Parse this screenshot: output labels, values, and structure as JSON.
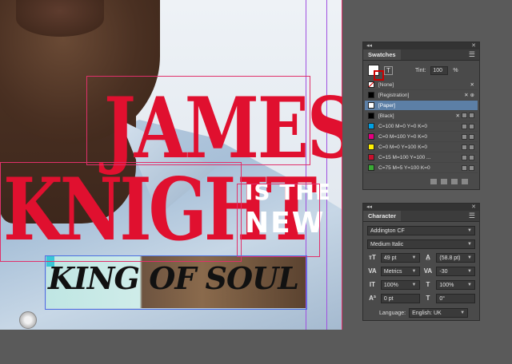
{
  "artwork": {
    "line1": "JAMES",
    "line2": "KNIGHT",
    "is_the": "IS THE",
    "new": "NEW",
    "banner": "KING OF SOUL"
  },
  "swatches": {
    "title": "Swatches",
    "tint_label": "Tint:",
    "tint_value": "100",
    "tint_unit": "%",
    "items": [
      {
        "name": "[None]",
        "color": "#ffffff"
      },
      {
        "name": "[Registration]",
        "color": "#000000"
      },
      {
        "name": "[Paper]",
        "color": "#ffffff"
      },
      {
        "name": "[Black]",
        "color": "#000000"
      },
      {
        "name": "C=100 M=0 Y=0 K=0",
        "color": "#00a0e3"
      },
      {
        "name": "C=0 M=100 Y=0 K=0",
        "color": "#e4007f"
      },
      {
        "name": "C=0 M=0 Y=100 K=0",
        "color": "#fff000"
      },
      {
        "name": "C=15 M=100 Y=100 ...",
        "color": "#c8102e"
      },
      {
        "name": "C=75 M=5 Y=100 K=0",
        "color": "#3aaa35"
      }
    ]
  },
  "character": {
    "title": "Character",
    "font_family": "Addington CF",
    "font_style": "Medium Italic",
    "font_size": "49 pt",
    "leading": "(58.8 pt)",
    "kerning": "Metrics",
    "tracking": "-30",
    "vertical_scale": "100%",
    "horizontal_scale": "100%",
    "baseline_shift": "0 pt",
    "skew": "0°",
    "language_label": "Language:",
    "language": "English: UK"
  }
}
